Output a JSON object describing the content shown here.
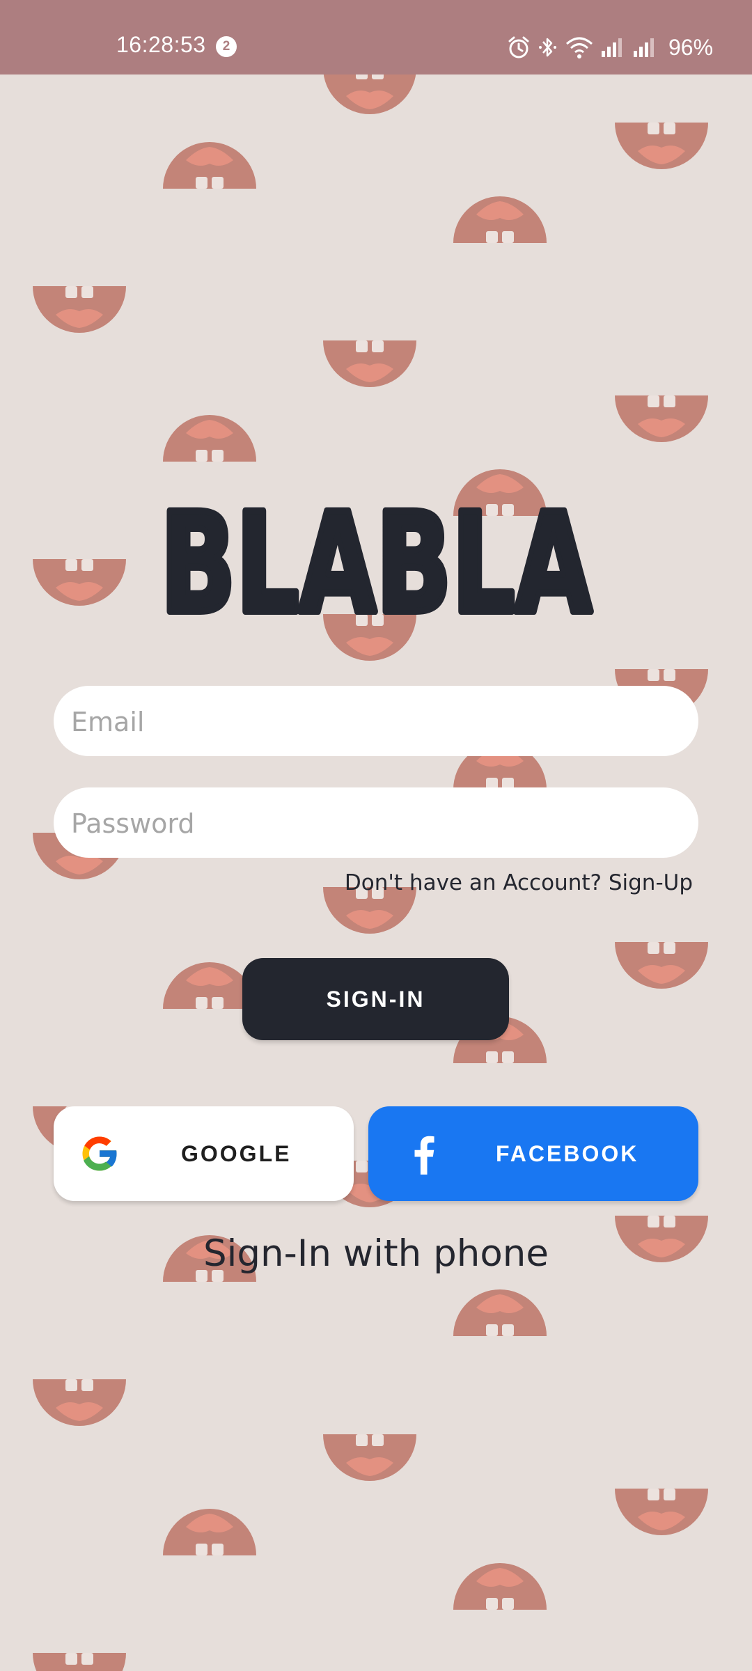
{
  "status_bar": {
    "time": "16:28:53",
    "notification_count": "2",
    "battery": "96%",
    "icons": [
      "alarm-icon",
      "bluetooth-icon",
      "wifi-icon",
      "signal-icon",
      "signal-icon"
    ]
  },
  "logo": {
    "text": "BLABLA"
  },
  "form": {
    "email_placeholder": "Email",
    "password_placeholder": "Password",
    "signup_link": "Don't have an Account? Sign-Up",
    "signin_label": "SIGN-IN"
  },
  "social": {
    "google_label": "GOOGLE",
    "facebook_label": "FACEBOOK"
  },
  "phone_signin": "Sign-In with phone",
  "colors": {
    "background": "#e6deda",
    "status_bar": "#ad7e80",
    "primary_dark": "#23262f",
    "facebook_blue": "#1977f2",
    "mouth": "#c38478",
    "tongue": "#e39181",
    "tooth": "#e8dcd8"
  }
}
